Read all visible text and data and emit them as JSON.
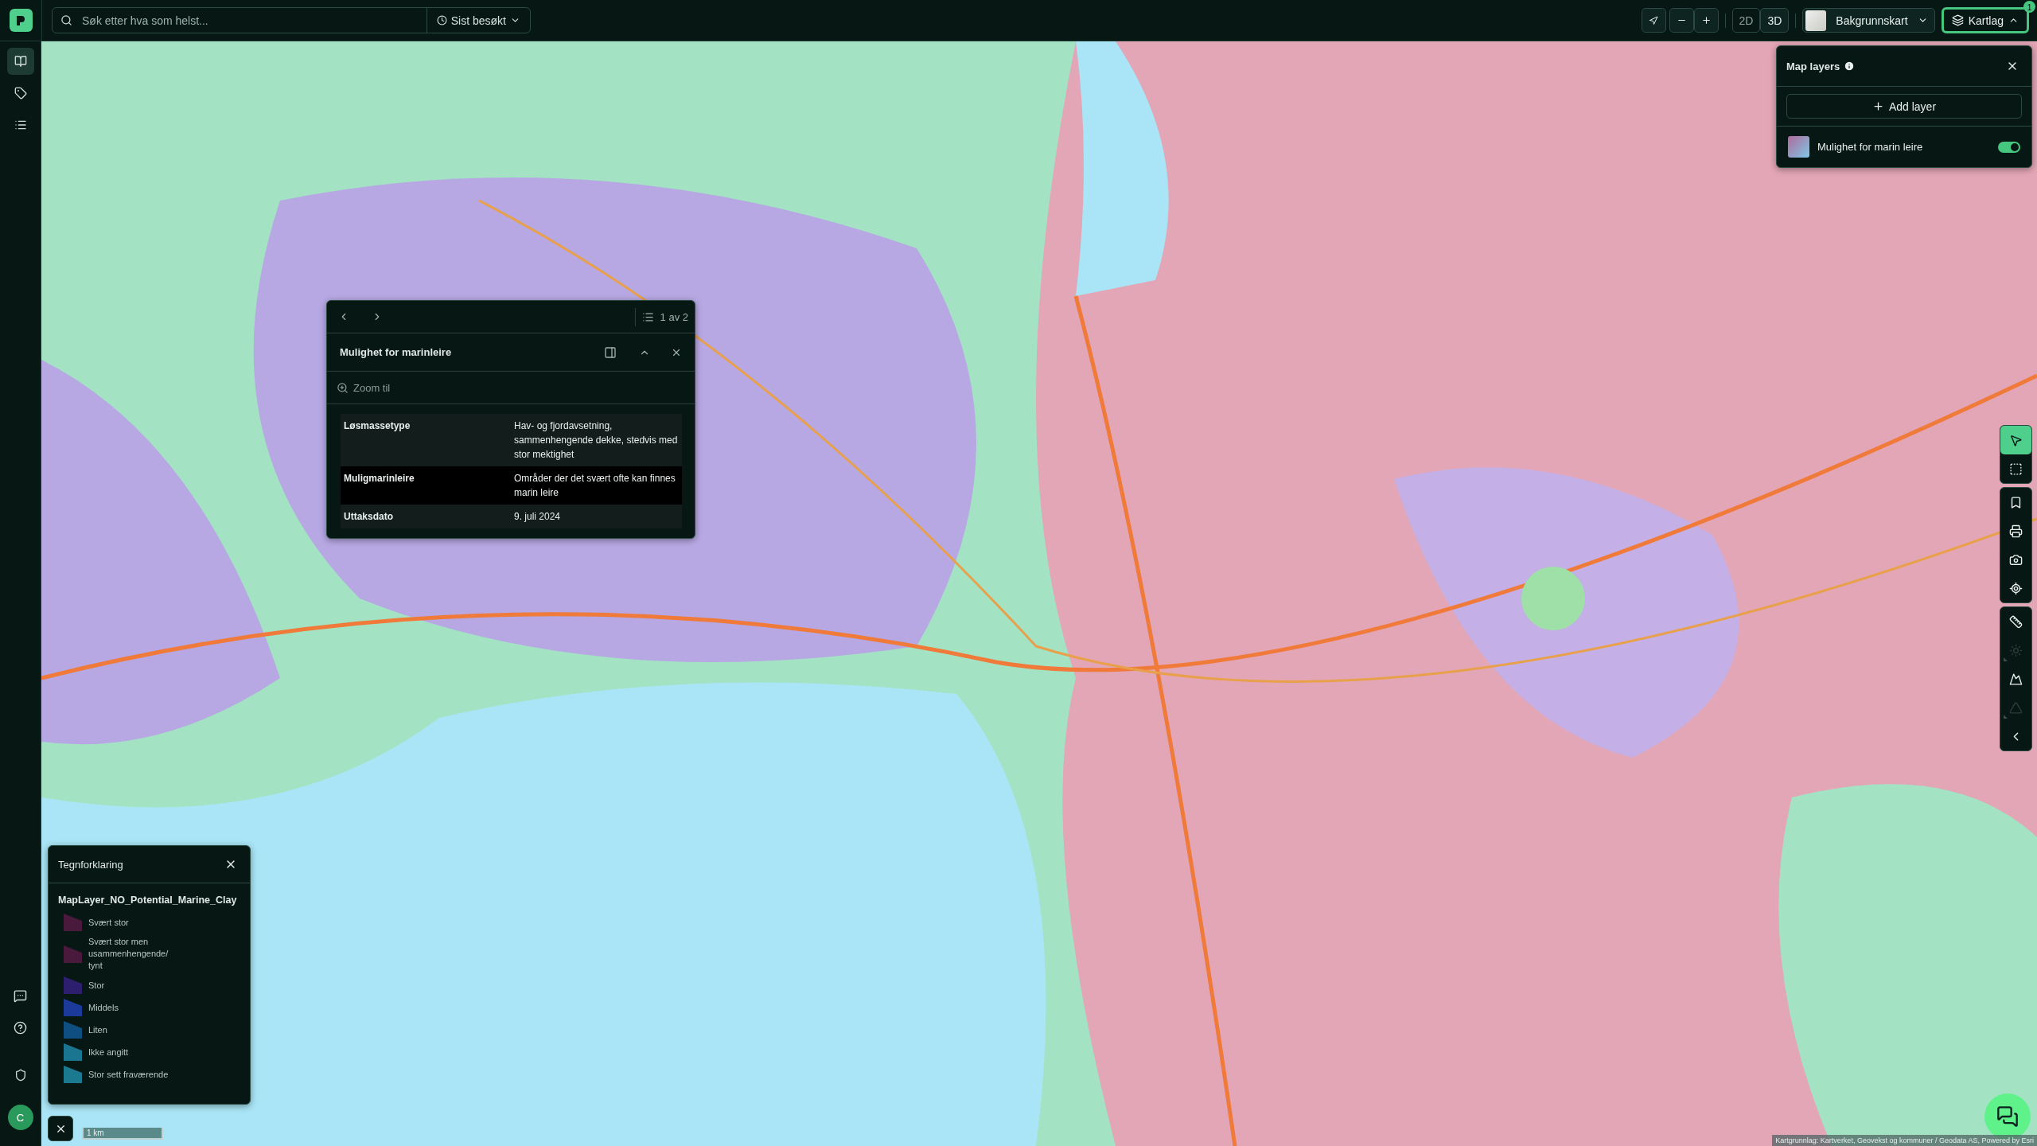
{
  "top_bar": {
    "search": {
      "placeholder": "Søk etter hva som helst..."
    },
    "recent": "Sist besøkt",
    "view_modes": [
      {
        "label": "2D",
        "selected": true
      },
      {
        "label": "3D",
        "selected": false
      }
    ],
    "basemap": "Bakgrunnskart",
    "layers_button": {
      "label": "Kartlag",
      "badge": "1",
      "expanded": true
    }
  },
  "sidebar": {
    "items": [
      {
        "kind": "map",
        "selected": true
      },
      {
        "kind": "tag",
        "selected": false
      },
      {
        "kind": "list",
        "selected": false
      }
    ],
    "user_initial": "C"
  },
  "map": {
    "kind": "picture",
    "attribution": "Kartgrunnlag: Kartverket, Geovekst og kommuner / Geodata AS, Powered by Esri",
    "scale": "1 km"
  },
  "popup": {
    "pager": "1 av 2",
    "title": "Mulighet for marinleire",
    "zoom_action": "Zoom til",
    "rows": [
      {
        "label": "Løsmassetype",
        "value": "Hav- og fjordavsetning, sammenhengende dekke, stedvis med stor mektighet",
        "highlighted": false
      },
      {
        "label": "Muligmarinleire",
        "value": "Områder der det svært ofte kan finnes marin leire",
        "highlighted": true
      },
      {
        "label": "Uttaksdato",
        "value": "9. juli 2024",
        "highlighted": false
      }
    ]
  },
  "layers_panel": {
    "title": "Map layers",
    "add_button": "Add layer",
    "layers": [
      {
        "name": "Mulighet for marin leire",
        "on": true
      }
    ]
  },
  "legend": {
    "title": "Tegnforklaring",
    "layer": "MapLayer_NO_Potential_Marine_Clay",
    "items": [
      {
        "label": "Svært stor",
        "color": "#4a1a3c"
      },
      {
        "label": "Svært stor men usammenhengende/ tynt",
        "color": "#4a1a3c"
      },
      {
        "label": "Stor",
        "color": "#2e1f6e"
      },
      {
        "label": "Middels",
        "color": "#1c3a9a"
      },
      {
        "label": "Liten",
        "color": "#0f4e80"
      },
      {
        "label": "Ikke angitt",
        "color": "#1a7590"
      },
      {
        "label": "Stor sett fraværende",
        "color": "#1b7a90"
      }
    ]
  },
  "tools": [
    {
      "kind": "select",
      "selected": true,
      "disabled": false
    },
    {
      "kind": "area",
      "selected": false,
      "disabled": false
    },
    {
      "kind": "bookmark",
      "selected": false,
      "disabled": false
    },
    {
      "kind": "print",
      "selected": false,
      "disabled": false
    },
    {
      "kind": "camera",
      "selected": false,
      "disabled": false
    },
    {
      "kind": "locate",
      "selected": false,
      "disabled": false
    },
    {
      "kind": "measure",
      "selected": false,
      "disabled": false
    },
    {
      "kind": "sun",
      "selected": false,
      "disabled": true
    },
    {
      "kind": "elevation",
      "selected": false,
      "disabled": false
    },
    {
      "kind": "viewshed",
      "selected": false,
      "disabled": true
    },
    {
      "kind": "collapse",
      "selected": false,
      "disabled": false
    }
  ]
}
